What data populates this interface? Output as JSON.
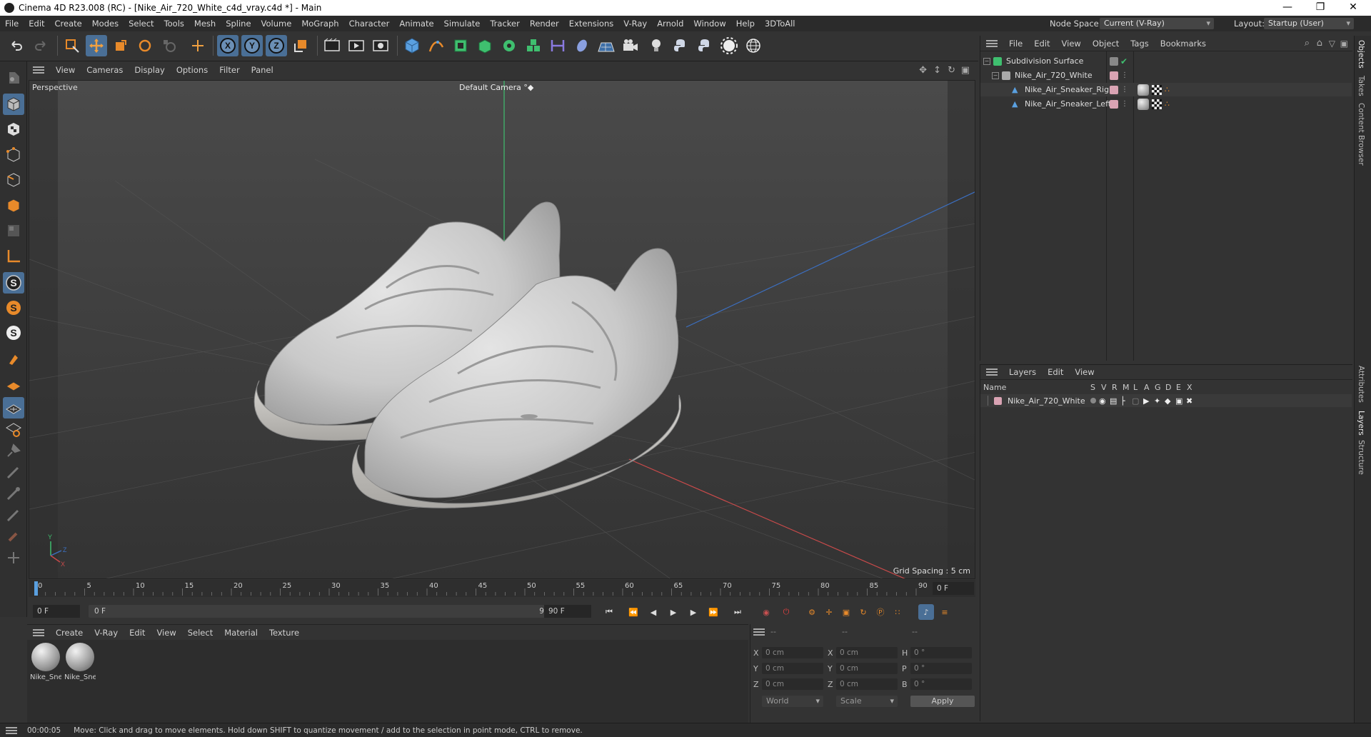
{
  "window": {
    "title": "Cinema 4D R23.008 (RC) - [Nike_Air_720_White_c4d_vray.c4d *] - Main",
    "minimize": "—",
    "maximize": "❐",
    "close": "✕"
  },
  "menubar": {
    "items": [
      "File",
      "Edit",
      "Create",
      "Modes",
      "Select",
      "Tools",
      "Mesh",
      "Spline",
      "Volume",
      "MoGraph",
      "Character",
      "Animate",
      "Simulate",
      "Tracker",
      "Render",
      "Extensions",
      "V-Ray",
      "Arnold",
      "Window",
      "Help",
      "3DToAll"
    ],
    "node_space_label": "Node Space:",
    "node_space_value": "Current (V-Ray)",
    "layout_label": "Layout:",
    "layout_value": "Startup (User)"
  },
  "toolbar": {
    "x_label": "X",
    "y_label": "Y",
    "z_label": "Z"
  },
  "left_tools": {
    "s1": "S",
    "s2": "S",
    "s3": "S"
  },
  "viewport_menu": {
    "items": [
      "View",
      "Cameras",
      "Display",
      "Options",
      "Filter",
      "Panel"
    ]
  },
  "viewport": {
    "name": "Perspective",
    "camera": "Default Camera",
    "camera_suffix": "°◆",
    "grid_spacing": "Grid Spacing : 5 cm",
    "axis_y": "Y",
    "axis_z": "Z",
    "axis_x": "X"
  },
  "timeline": {
    "ticks": [
      "0",
      "5",
      "10",
      "15",
      "20",
      "25",
      "30",
      "35",
      "40",
      "45",
      "50",
      "55",
      "60",
      "65",
      "70",
      "75",
      "80",
      "85",
      "90"
    ],
    "current_frame_right": "0 F"
  },
  "transport": {
    "start_field": "0 F",
    "range_start": "0 F",
    "range_end": "90 F",
    "end_field": "90 F"
  },
  "material_menu": {
    "items": [
      "Create",
      "V-Ray",
      "Edit",
      "View",
      "Select",
      "Material",
      "Texture"
    ]
  },
  "materials": [
    {
      "label": "Nike_Sne"
    },
    {
      "label": "Nike_Sne"
    }
  ],
  "coords": {
    "head1": "--",
    "head2": "--",
    "head3": "--",
    "x_label": "X",
    "y_label": "Y",
    "z_label": "Z",
    "x2_label": "X",
    "y2_label": "Y",
    "z2_label": "Z",
    "h_label": "H",
    "p_label": "P",
    "b_label": "B",
    "pos_x": "0 cm",
    "pos_y": "0 cm",
    "pos_z": "0 cm",
    "size_x": "0 cm",
    "size_y": "0 cm",
    "size_z": "0 cm",
    "rot_h": "0 °",
    "rot_p": "0 °",
    "rot_b": "0 °",
    "mode1": "World",
    "mode2": "Scale",
    "apply": "Apply"
  },
  "object_manager": {
    "menu": [
      "File",
      "Edit",
      "View",
      "Object",
      "Tags",
      "Bookmarks"
    ],
    "objects": [
      {
        "name": "Subdivision Surface"
      },
      {
        "name": "Nike_Air_720_White"
      },
      {
        "name": "Nike_Air_Sneaker_Right"
      },
      {
        "name": "Nike_Air_Sneaker_Left"
      }
    ]
  },
  "layer_manager": {
    "menu": [
      "Layers",
      "Edit",
      "View"
    ],
    "columns": {
      "name": "Name",
      "flags": [
        "S",
        "V",
        "R",
        "M",
        "L",
        "A",
        "G",
        "D",
        "E",
        "X"
      ]
    },
    "layers": [
      {
        "name": "Nike_Air_720_White"
      }
    ]
  },
  "right_tabs": {
    "objects": "Objects",
    "takes": "Takes",
    "content_browser": "Content Browser",
    "attributes": "Attributes",
    "layers": "Layers",
    "structure": "Structure"
  },
  "status": {
    "time": "00:00:05",
    "message": "Move: Click and drag to move elements. Hold down SHIFT to quantize movement / add to the selection in point mode, CTRL to remove."
  },
  "colors": {
    "accent_blue": "#4a6f96",
    "layer_color": "#d9a3b3",
    "axis_green": "#3fbf6f",
    "axis_red": "#c84a4a",
    "axis_blue": "#3c6fc0",
    "timeline_marker": "#5aa0e0"
  }
}
